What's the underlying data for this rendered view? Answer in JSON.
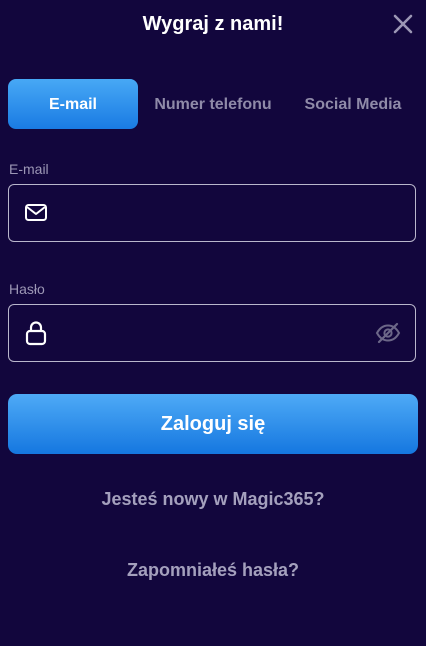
{
  "header": {
    "title": "Wygraj z nami!"
  },
  "tabs": [
    {
      "label": "E-mail",
      "active": true
    },
    {
      "label": "Numer telefonu",
      "active": false
    },
    {
      "label": "Social Media",
      "active": false
    }
  ],
  "form": {
    "email": {
      "label": "E-mail",
      "value": "",
      "icon": "mail-icon"
    },
    "password": {
      "label": "Hasło",
      "value": "",
      "icon": "lock-icon",
      "toggle_icon": "eye-off-icon"
    },
    "submit_label": "Zaloguj się"
  },
  "links": {
    "register": "Jesteś nowy w Magic365?",
    "forgot_password": "Zapomniałeś hasła?"
  },
  "colors": {
    "background": "#12063d",
    "accent": "#1a7be3",
    "muted_text": "#a4a0bd"
  }
}
